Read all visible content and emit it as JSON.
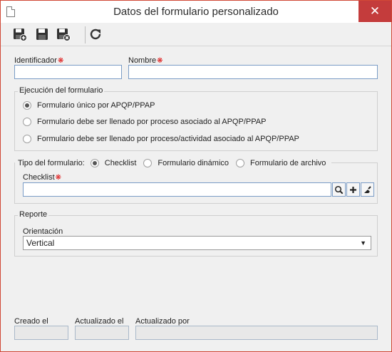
{
  "window": {
    "title": "Datos del formulario personalizado",
    "close_glyph": "✕"
  },
  "toolbar": {
    "buttons": [
      {
        "icon": "save-new-icon"
      },
      {
        "icon": "save-icon"
      },
      {
        "icon": "save-close-icon"
      },
      {
        "icon": "refresh-icon"
      }
    ]
  },
  "fields": {
    "identificador_label": "Identificador",
    "identificador_value": "",
    "nombre_label": "Nombre",
    "nombre_value": ""
  },
  "ejecucion": {
    "legend": "Ejecución del formulario",
    "options": [
      {
        "label": "Formulario único por APQP/PPAP",
        "checked": true
      },
      {
        "label": "Formulario debe ser llenado por proceso asociado al APQP/PPAP",
        "checked": false
      },
      {
        "label": "Formulario debe ser llenado por proceso/actividad asociado al APQP/PPAP",
        "checked": false
      }
    ]
  },
  "tipo": {
    "legend": "Tipo del formulario:",
    "options": [
      {
        "label": "Checklist",
        "checked": true
      },
      {
        "label": "Formulario dinámico",
        "checked": false
      },
      {
        "label": "Formulario de archivo",
        "checked": false
      }
    ],
    "checklist_label": "Checklist",
    "checklist_value": ""
  },
  "reporte": {
    "legend": "Reporte",
    "orientacion_label": "Orientación",
    "orientacion_value": "Vertical"
  },
  "footer": {
    "creado_label": "Creado el",
    "actualizado_label": "Actualizado el",
    "actualizado_por_label": "Actualizado por"
  },
  "colors": {
    "accent": "#c43c3c",
    "field_border": "#7a9cc6",
    "required": "#dd1111"
  }
}
